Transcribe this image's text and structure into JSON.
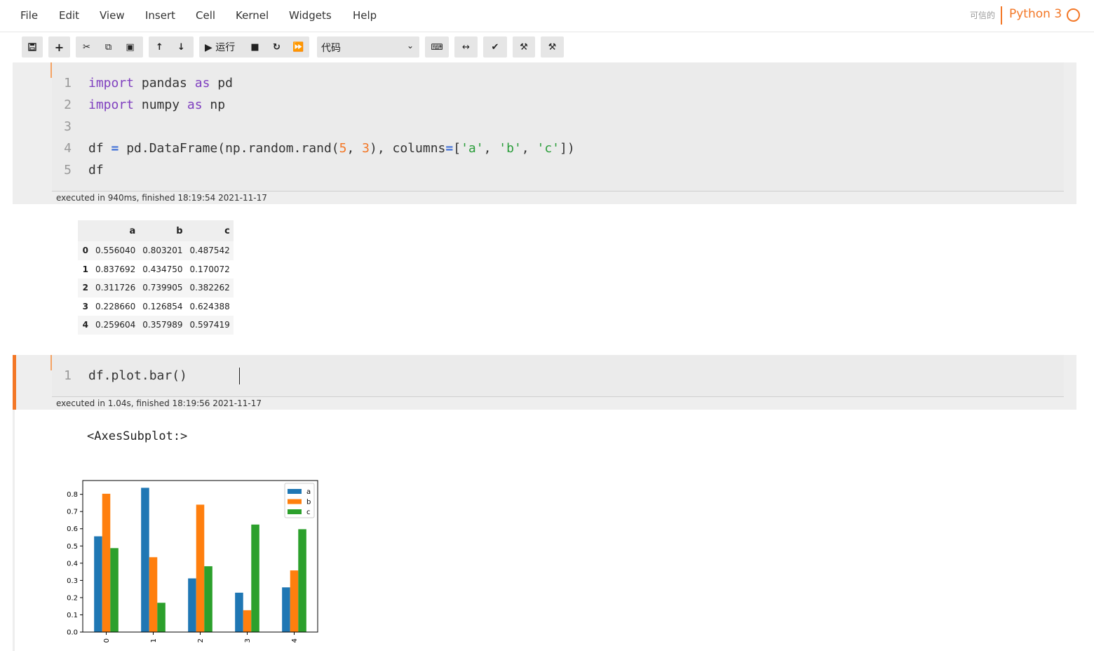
{
  "menu": {
    "items": [
      "File",
      "Edit",
      "View",
      "Insert",
      "Cell",
      "Kernel",
      "Widgets",
      "Help"
    ]
  },
  "kernel": {
    "trusted_label": "可信的",
    "name": "Python 3",
    "accent": "#f37726"
  },
  "toolbar": {
    "run_label": "▶ 运行",
    "cell_type": "代码",
    "icons": [
      "save-icon",
      "plus-icon",
      "cut-icon",
      "copy-icon",
      "paste-icon",
      "arrow-up-icon",
      "arrow-down-icon",
      "run-icon",
      "stop-icon",
      "restart-icon",
      "fast-forward-icon",
      "keyboard-icon",
      "arrows-h-icon",
      "check-icon",
      "gavel-icon",
      "gavel-icon"
    ]
  },
  "cell1": {
    "line_numbers": [
      "1",
      "2",
      "3",
      "4",
      "5"
    ],
    "exec_info": "executed in 940ms, finished 18:19:54 2021-11-17"
  },
  "dataframe": {
    "columns": [
      "",
      "a",
      "b",
      "c"
    ],
    "rows": [
      [
        "0",
        "0.556040",
        "0.803201",
        "0.487542"
      ],
      [
        "1",
        "0.837692",
        "0.434750",
        "0.170072"
      ],
      [
        "2",
        "0.311726",
        "0.739905",
        "0.382262"
      ],
      [
        "3",
        "0.228660",
        "0.126854",
        "0.624388"
      ],
      [
        "4",
        "0.259604",
        "0.357989",
        "0.597419"
      ]
    ]
  },
  "cell2": {
    "line_numbers": [
      "1"
    ],
    "code": "df.plot.bar()",
    "exec_info": "executed in 1.04s, finished 18:19:56 2021-11-17",
    "output_text": "<AxesSubplot:>"
  },
  "chart_data": {
    "type": "bar",
    "categories": [
      "0",
      "1",
      "2",
      "3",
      "4"
    ],
    "series": [
      {
        "name": "a",
        "color": "#1f77b4",
        "values": [
          0.55604,
          0.837692,
          0.311726,
          0.22866,
          0.259604
        ]
      },
      {
        "name": "b",
        "color": "#ff7f0e",
        "values": [
          0.803201,
          0.43475,
          0.739905,
          0.126854,
          0.357989
        ]
      },
      {
        "name": "c",
        "color": "#2ca02c",
        "values": [
          0.487542,
          0.170072,
          0.382262,
          0.624388,
          0.597419
        ]
      }
    ],
    "yticks": [
      "0.0",
      "0.1",
      "0.2",
      "0.3",
      "0.4",
      "0.5",
      "0.6",
      "0.7",
      "0.8"
    ],
    "ylim": [
      0,
      0.88
    ],
    "legend": "top-right",
    "title": "",
    "xlabel": "",
    "ylabel": ""
  }
}
